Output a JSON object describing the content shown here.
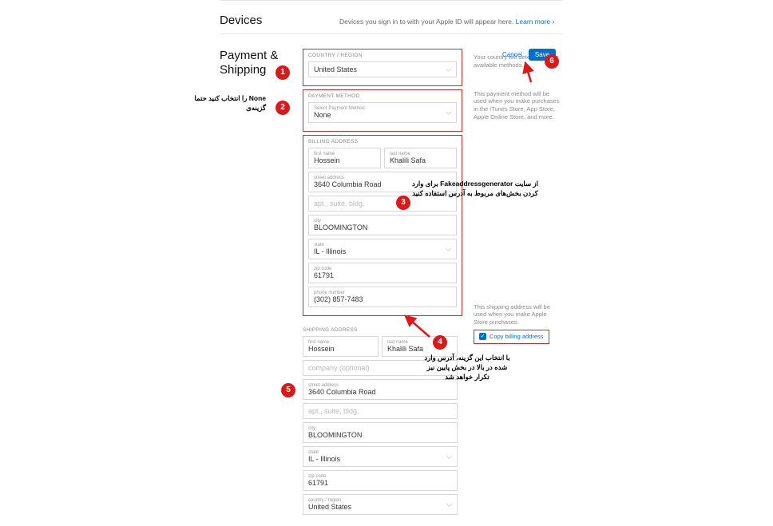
{
  "devices": {
    "title": "Devices",
    "text": "Devices you sign in to with your Apple ID will appear here.",
    "link": "Learn more ›"
  },
  "payment": {
    "title": "Payment & Shipping",
    "country_label": "COUNTRY / REGION",
    "country_value": "United States",
    "country_desc": "Your country will determine your available methods.",
    "method_label": "PAYMENT METHOD",
    "method_sublabel": "Select Payment Method",
    "method_value": "None",
    "method_desc": "This payment method will be used when you make purchases in the iTunes Store, App Store, Apple Online Store, and more.",
    "billing_label": "BILLING ADDRESS",
    "shipping_label": "SHIPPING ADDRESS",
    "shipping_desc": "This shipping address will be used when you make Apple Store purchases.",
    "copy_label": "Copy billing address",
    "cancel": "Cancel",
    "save": "Save"
  },
  "labels": {
    "first_name": "first name",
    "last_name": "last name",
    "street": "street address",
    "apt": "apt., suite, bldg.",
    "city": "city",
    "state": "state",
    "zip": "zip code",
    "phone": "phone number",
    "company": "company (optional)",
    "country": "country / region"
  },
  "billing": {
    "first_name": "Hossein",
    "last_name": "Khalili Safa",
    "street": "3640  Columbia Road",
    "city": "BLOOMINGTON",
    "state": "IL - Illinois",
    "zip": "61791",
    "phone": "(302) 857-7483"
  },
  "shipping": {
    "first_name": "Hossein",
    "last_name": "Khalili Safa",
    "street": "3640  Columbia Road",
    "city": "BLOOMINGTON",
    "state": "IL - Illinois",
    "zip": "61791",
    "country": "United States"
  },
  "annotations": {
    "a1": "1",
    "a2": "2",
    "a3": "3",
    "a4": "4",
    "a5": "5",
    "a6": "6",
    "note_left": "None را انتخاب کنید\nحتما گزینه‌ی",
    "note3": "از سایت Fakeaddressgenerator\nبرای وارد کردن بخش‌های مربوط به آدرس\nاستفاده کنید",
    "note4": "با انتخاب این گزینه، آدرس\nوارد شده در بالا در بخش\nپایین نیز تکرار خواهد شد"
  }
}
